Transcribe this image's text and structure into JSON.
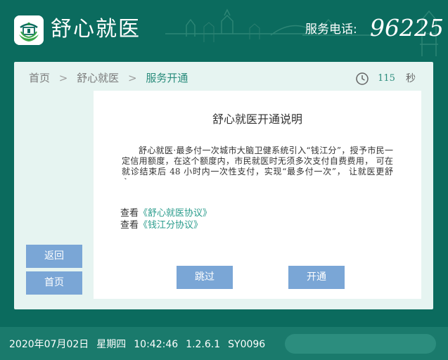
{
  "header": {
    "app_title": "舒心就医",
    "hotline_label": "服务电话:",
    "hotline_number": "96225",
    "logo_icon": "hospital-logo-icon"
  },
  "breadcrumb": {
    "home": "首页",
    "parent": "舒心就医",
    "current": "服务开通"
  },
  "timer": {
    "seconds": "115",
    "unit": "秒",
    "icon": "clock-icon"
  },
  "sidebar": {
    "back_label": "返回",
    "home_label": "首页"
  },
  "content": {
    "title": "舒心就医开通说明",
    "body": "舒心就医·最多付一次城市大脑卫健系统引入“钱江分”，授予市民一定信用额度，在这个额度内，市民就医时无须多次支付自费费用， 可在就诊结束后 48 小时内一次性支付，实现“最多付一次”， 让就医更舒心。",
    "link1_prefix": "查看",
    "link1_text": "《舒心就医协议》",
    "link2_prefix": "查看",
    "link2_text": "《钱江分协议》",
    "skip_label": "跳过",
    "open_label": "开通"
  },
  "footer": {
    "date": "2020年07月02日",
    "weekday": "星期四",
    "time": "10:42:46",
    "version": "1.2.6.1",
    "terminal_id": "SY0096"
  },
  "colors": {
    "header_bg": "#0b6b5e",
    "panel_bg": "#e6f4f1",
    "button_bg": "#7aa6d6",
    "accent_text": "#2a8c7c"
  }
}
